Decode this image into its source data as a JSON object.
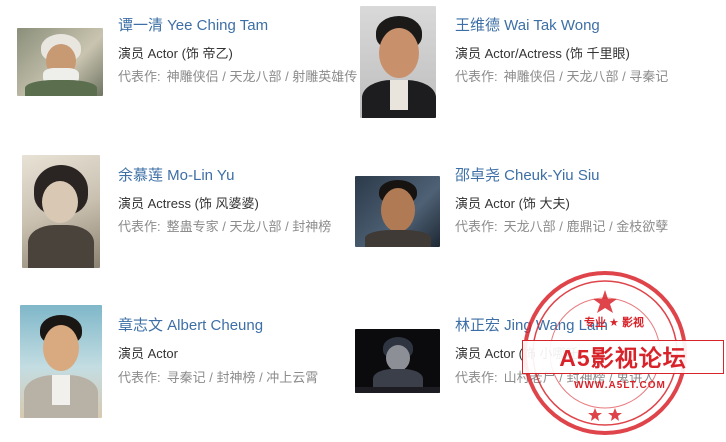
{
  "people": [
    {
      "name": "谭一清 Yee Ching Tam",
      "role": "演员 Actor (饰 帝乙)",
      "works_label": "代表作:",
      "works": "神雕侠侣 / 天龙八部 / 射雕英雄传"
    },
    {
      "name": "王维德 Wai Tak Wong",
      "role": "演员 Actor/Actress (饰 千里眼)",
      "works_label": "代表作:",
      "works": "神雕侠侣 / 天龙八部 / 寻秦记"
    },
    {
      "name": "余慕莲 Mo-Lin Yu",
      "role": "演员 Actress (饰 风婆婆)",
      "works_label": "代表作:",
      "works": "整蛊专家 / 天龙八部 / 封神榜"
    },
    {
      "name": "邵卓尧 Cheuk-Yiu Siu",
      "role": "演员 Actor (饰 大夫)",
      "works_label": "代表作:",
      "works": "天龙八部 / 鹿鼎记 / 金枝欲孽"
    },
    {
      "name": "章志文 Albert Cheung",
      "role": "演员 Actor",
      "works_label": "代表作:",
      "works": "寻秦记 / 封神榜 / 冲上云霄"
    },
    {
      "name": "林正宏 Jing Wang Lam",
      "role": "演员 Actor (饰 小哪吒)",
      "works_label": "代表作:",
      "works": "山村老尸 / 封神榜 / 鬼讲人"
    }
  ],
  "watermark": {
    "top_text": "专业 ★ 影视",
    "main_text": "A5影视论坛",
    "url": "WWW.A5LT.COM"
  },
  "colors": {
    "name_link": "#3d6fa6",
    "role_text": "#333333",
    "works_text": "#8c8c8c",
    "stamp_red": "#d8232a"
  }
}
